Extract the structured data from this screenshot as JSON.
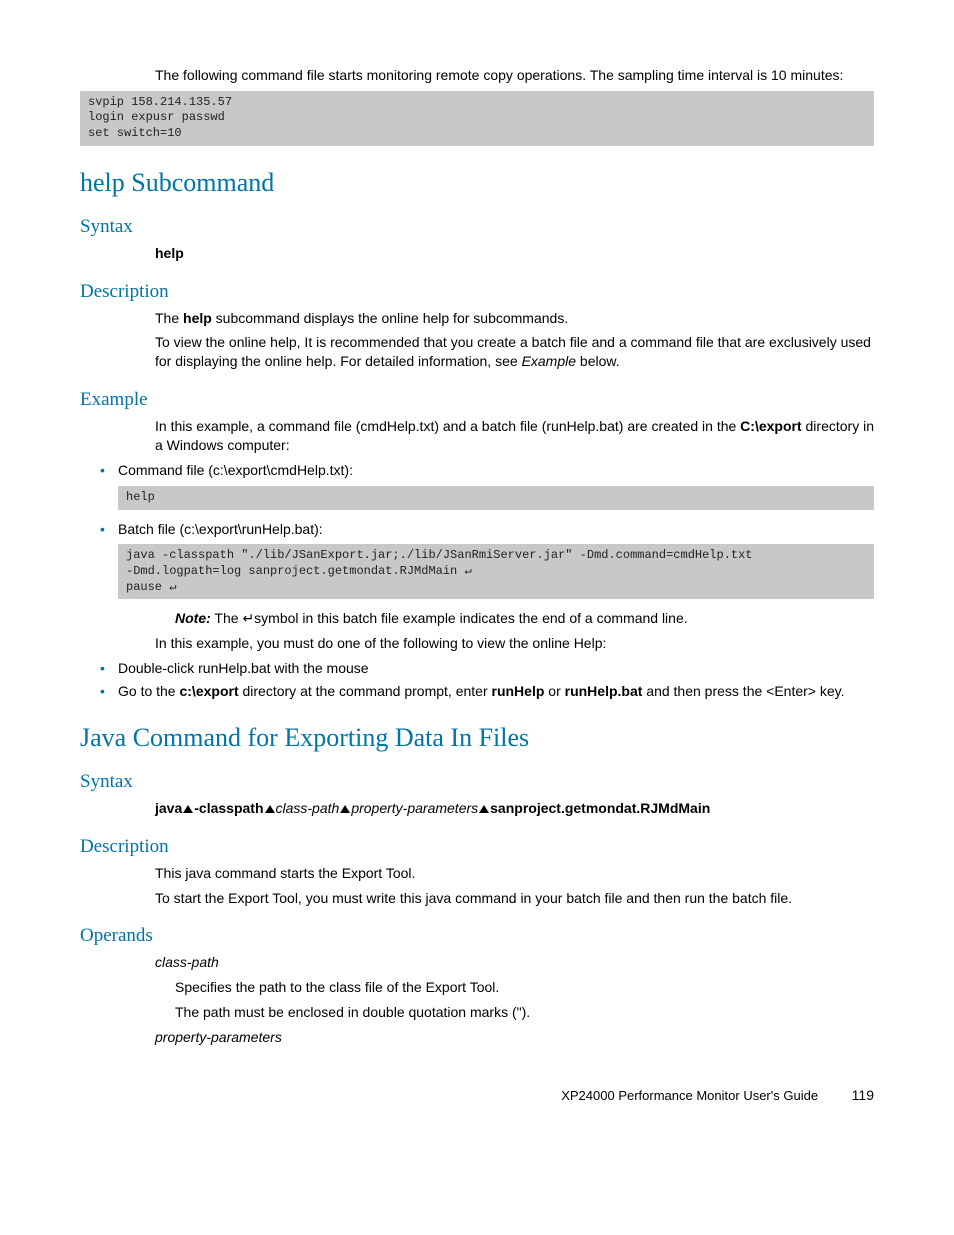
{
  "intro_p1": "The following command file starts monitoring remote copy operations. The sampling time interval is 10 minutes:",
  "code1": "svpip 158.214.135.57\nlogin expusr passwd\nset switch=10",
  "help_heading": "help Subcommand",
  "syntax_heading": "Syntax",
  "help_syntax": "help",
  "desc_heading": "Description",
  "help_desc_p1_a": "The ",
  "help_desc_p1_b": "help",
  "help_desc_p1_c": " subcommand displays the online help for subcommands.",
  "help_desc_p2_a": "To view the online help, It is recommended that you create a batch file and a command file that are exclusively used for displaying the online help. For detailed information, see ",
  "help_desc_p2_b": "Example",
  "help_desc_p2_c": " below.",
  "example_heading": "Example",
  "example_p1_a": "In this example, a command file (cmdHelp.txt) and a batch file (runHelp.bat) are created in the ",
  "example_p1_b": "C:\\export",
  "example_p1_c": " directory in a Windows computer:",
  "li_cmdfile": "Command file (c:\\export\\cmdHelp.txt):",
  "code2": "help",
  "li_batchfile": "Batch file (c:\\export\\runHelp.bat):",
  "code3": "java -classpath \"./lib/JSanExport.jar;./lib/JSanRmiServer.jar\" -Dmd.command=cmdHelp.txt\n-Dmd.logpath=log sanproject.getmondat.RJMdMain ↵\npause ↵",
  "note_label": "Note:",
  "note_text_a": " The ",
  "note_text_b": "↵",
  "note_text_c": "symbol in this batch file example indicates the end of a command line.",
  "example_p2": "In this example, you must do one of the following to view the online Help:",
  "li_dbl": "Double-click runHelp.bat with the mouse",
  "li_goto_a": "Go to the ",
  "li_goto_b": "c:\\export",
  "li_goto_c": " directory at the command prompt, enter ",
  "li_goto_d": "runHelp",
  "li_goto_e": " or ",
  "li_goto_f": "runHelp.bat",
  "li_goto_g": " and then press the <Enter> key.",
  "java_heading": "Java Command for Exporting Data In Files",
  "java_syntax_a": "java",
  "java_syntax_b": "-classpath",
  "java_syntax_c": "class-path",
  "java_syntax_d": "property-parameters",
  "java_syntax_e": "sanproject.getmondat.RJMdMain",
  "java_desc_p1": "This java command starts the Export Tool.",
  "java_desc_p2": "To start the Export Tool, you must write this java command in your batch file and then run the batch file.",
  "operands_heading": "Operands",
  "op1_name": "class-path",
  "op1_p1": "Specifies the path to the class file of the Export Tool.",
  "op1_p2": "The path must be enclosed in double quotation marks (\").",
  "op2_name": "property-parameters",
  "footer_text": "XP24000 Performance Monitor User's Guide",
  "page_num": "119"
}
